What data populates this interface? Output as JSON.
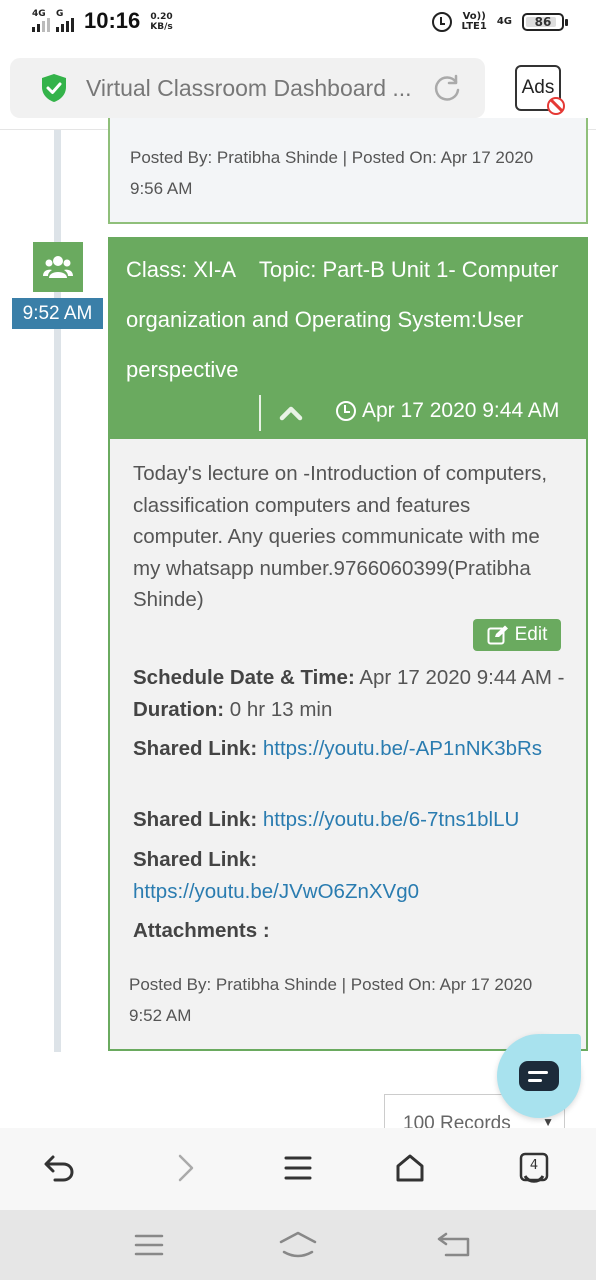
{
  "status_bar": {
    "sim1_label": "4G",
    "sim2_label": "G",
    "time": "10:16",
    "speed_value": "0.20",
    "speed_unit": "KB/s",
    "volte_top": "Vo))",
    "volte_bottom": "LTE1",
    "net_label": "4G",
    "battery": "86"
  },
  "browser": {
    "url_title": "Virtual Classroom Dashboard ...",
    "ads_label": "Ads"
  },
  "previous_card": {
    "posted": "Posted By: Pratibha Shinde | Posted On: Apr 17 2020 9:56 AM"
  },
  "timeline": {
    "time_badge": "9:52 AM"
  },
  "card": {
    "title": "Class: XI-A    Topic: Part-B Unit 1- Computer organization and Operating System:User perspective",
    "date": "Apr 17 2020 9:44 AM",
    "description": "Today's lecture on -Introduction of computers, classification computers and features computer. Any queries communicate with me my whatsapp number.9766060399(Pratibha Shinde)",
    "edit_label": "Edit",
    "schedule_label": "Schedule Date & Time:",
    "schedule_value": " Apr 17 2020 9:44 AM - ",
    "duration_label": "Duration:",
    "duration_value": " 0 hr 13 min",
    "shared_link_label": "Shared Link:",
    "links": [
      "https://youtu.be/-AP1nNK3bRs",
      "https://youtu.be/6-7tns1blLU",
      "https://youtu.be/JVwO6ZnXVg0"
    ],
    "attachments_label": "Attachments :",
    "posted": "Posted By: Pratibha Shinde | Posted On: Apr 17 2020 9:52 AM"
  },
  "records_select": {
    "value": "100 Records"
  },
  "colors": {
    "accent_green": "#6aaa5f",
    "time_badge_blue": "#3a7fa8",
    "link_blue": "#2a7cb0",
    "chat_fab": "#a8e2ee"
  },
  "icons": {
    "secure": "shield-check-icon",
    "reload": "reload-icon",
    "group": "users-icon",
    "collapse": "chevron-up-icon",
    "clock": "clock-icon",
    "edit": "edit-icon",
    "chat": "chat-icon",
    "back": "back-icon",
    "forward": "forward-icon",
    "menu": "menu-icon",
    "home": "home-icon",
    "tabs": "tabs-icon"
  },
  "toolbar": {
    "tabs_count": "4"
  }
}
